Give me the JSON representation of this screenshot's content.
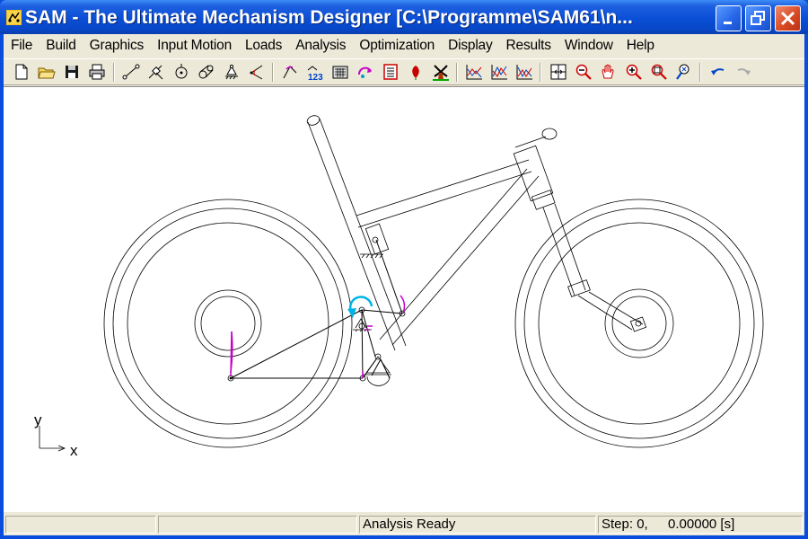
{
  "window": {
    "title": "SAM - The Ultimate Mechanism Designer [C:\\Programme\\SAM61\\n...",
    "buttons": [
      "minimize",
      "maximize",
      "close"
    ]
  },
  "menu": [
    {
      "label": "File"
    },
    {
      "label": "Build"
    },
    {
      "label": "Graphics"
    },
    {
      "label": "Input Motion"
    },
    {
      "label": "Loads"
    },
    {
      "label": "Analysis"
    },
    {
      "label": "Optimization"
    },
    {
      "label": "Display"
    },
    {
      "label": "Results"
    },
    {
      "label": "Window"
    },
    {
      "label": "Help"
    }
  ],
  "toolbar": {
    "groups": [
      [
        "new-file-icon",
        "open-folder-icon",
        "save-disk-icon",
        "print-icon"
      ],
      [
        "beam-element-icon",
        "slider-element-icon",
        "gear-element-icon",
        "belt-element-icon",
        "fixed-support-icon",
        "angle-element-icon"
      ],
      [
        "input-motion-icon",
        "numbering-icon",
        "calculator-icon",
        "load-icon",
        "analysis-icon",
        "optimization-icon",
        "windmill-icon"
      ],
      [
        "graph-icon",
        "graph-2-icon",
        "graph-3-icon"
      ],
      [
        "fit-view-icon",
        "zoom-out-icon",
        "pan-icon",
        "zoom-in-icon",
        "zoom-window-icon",
        "zoom-redraw-icon"
      ],
      [
        "undo-icon",
        "redo-icon"
      ]
    ]
  },
  "canvas": {
    "axis_x_label": "x",
    "axis_y_label": "y"
  },
  "status": {
    "pane1": "",
    "pane2": "",
    "message": "Analysis Ready",
    "step_label": "Step: 0,",
    "time_value": "0.00000 [s]"
  },
  "colors": {
    "titlebar": "#0a4fd6",
    "accent_cyan": "#00b4e6",
    "accent_magenta": "#c800c8",
    "accent_red": "#d7461f"
  }
}
